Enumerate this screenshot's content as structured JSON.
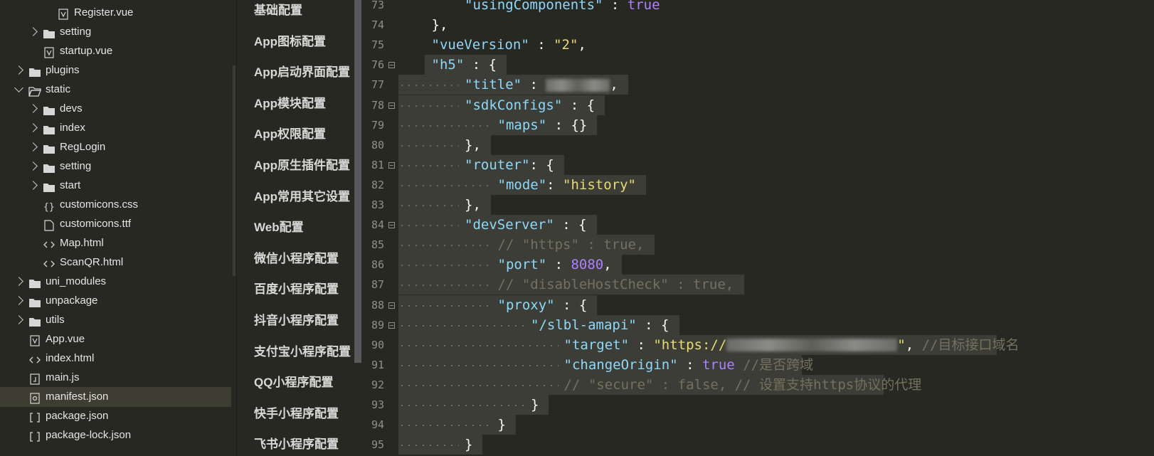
{
  "file_tree": {
    "items": [
      {
        "label": "Register.vue",
        "type": "vue",
        "depth": 3,
        "expanded": null
      },
      {
        "label": "setting",
        "type": "folder",
        "depth": 2,
        "expanded": false
      },
      {
        "label": "startup.vue",
        "type": "vue",
        "depth": 2,
        "expanded": null
      },
      {
        "label": "plugins",
        "type": "folder",
        "depth": 1,
        "expanded": false
      },
      {
        "label": "static",
        "type": "folder-open",
        "depth": 1,
        "expanded": true
      },
      {
        "label": "devs",
        "type": "folder",
        "depth": 2,
        "expanded": false
      },
      {
        "label": "index",
        "type": "folder",
        "depth": 2,
        "expanded": false
      },
      {
        "label": "RegLogin",
        "type": "folder",
        "depth": 2,
        "expanded": false
      },
      {
        "label": "setting",
        "type": "folder",
        "depth": 2,
        "expanded": false
      },
      {
        "label": "start",
        "type": "folder",
        "depth": 2,
        "expanded": false
      },
      {
        "label": "customicons.css",
        "type": "css",
        "depth": 2,
        "expanded": null
      },
      {
        "label": "customicons.ttf",
        "type": "file",
        "depth": 2,
        "expanded": null
      },
      {
        "label": "Map.html",
        "type": "html",
        "depth": 2,
        "expanded": null
      },
      {
        "label": "ScanQR.html",
        "type": "html",
        "depth": 2,
        "expanded": null
      },
      {
        "label": "uni_modules",
        "type": "folder",
        "depth": 1,
        "expanded": false
      },
      {
        "label": "unpackage",
        "type": "folder",
        "depth": 1,
        "expanded": false
      },
      {
        "label": "utils",
        "type": "folder",
        "depth": 1,
        "expanded": false
      },
      {
        "label": "App.vue",
        "type": "vue",
        "depth": 1,
        "expanded": null
      },
      {
        "label": "index.html",
        "type": "html",
        "depth": 1,
        "expanded": null
      },
      {
        "label": "main.js",
        "type": "js",
        "depth": 1,
        "expanded": null
      },
      {
        "label": "manifest.json",
        "type": "json-settings",
        "depth": 1,
        "expanded": null,
        "selected": true
      },
      {
        "label": "package.json",
        "type": "json",
        "depth": 1,
        "expanded": null
      },
      {
        "label": "package-lock.json",
        "type": "json",
        "depth": 1,
        "expanded": null
      }
    ]
  },
  "settings_nav": {
    "items": [
      "基础配置",
      "App图标配置",
      "App启动界面配置",
      "App模块配置",
      "App权限配置",
      "App原生插件配置",
      "App常用其它设置",
      "Web配置",
      "微信小程序配置",
      "百度小程序配置",
      "抖音小程序配置",
      "支付宝小程序配置",
      "QQ小程序配置",
      "快手小程序配置",
      "飞书小程序配置"
    ]
  },
  "editor": {
    "lines": [
      {
        "num": "73",
        "indent": 2,
        "fold": false,
        "tokens": [
          [
            "key",
            "\"usingComponents\""
          ],
          [
            "p",
            " : "
          ],
          [
            "kw",
            "true"
          ]
        ]
      },
      {
        "num": "74",
        "indent": 1,
        "fold": false,
        "tokens": [
          [
            "p",
            "},"
          ]
        ]
      },
      {
        "num": "75",
        "indent": 1,
        "fold": false,
        "tokens": [
          [
            "key",
            "\"vueVersion\""
          ],
          [
            "p",
            " : "
          ],
          [
            "str",
            "\"2\""
          ],
          [
            "p",
            ","
          ]
        ]
      },
      {
        "num": "76",
        "indent": 1,
        "fold": true,
        "tokens": [
          [
            "key",
            "\"h5\""
          ],
          [
            "p",
            " : {"
          ]
        ]
      },
      {
        "num": "77",
        "indent": 2,
        "fold": false,
        "tokens": [
          [
            "key",
            "\"title\""
          ],
          [
            "p",
            " : "
          ],
          [
            "blur",
            "90"
          ],
          [
            "p",
            ","
          ]
        ]
      },
      {
        "num": "78",
        "indent": 2,
        "fold": true,
        "tokens": [
          [
            "key",
            "\"sdkConfigs\""
          ],
          [
            "p",
            " : {"
          ]
        ]
      },
      {
        "num": "79",
        "indent": 3,
        "fold": false,
        "tokens": [
          [
            "key",
            "\"maps\""
          ],
          [
            "p",
            " : {}"
          ]
        ]
      },
      {
        "num": "80",
        "indent": 2,
        "fold": false,
        "tokens": [
          [
            "p",
            "},"
          ]
        ]
      },
      {
        "num": "81",
        "indent": 2,
        "fold": true,
        "tokens": [
          [
            "key",
            "\"router\""
          ],
          [
            "p",
            ": {"
          ]
        ]
      },
      {
        "num": "82",
        "indent": 3,
        "fold": false,
        "tokens": [
          [
            "key",
            "\"mode\""
          ],
          [
            "p",
            ": "
          ],
          [
            "str",
            "\"history\""
          ]
        ]
      },
      {
        "num": "83",
        "indent": 2,
        "fold": false,
        "tokens": [
          [
            "p",
            "},"
          ]
        ]
      },
      {
        "num": "84",
        "indent": 2,
        "fold": true,
        "tokens": [
          [
            "key",
            "\"devServer\""
          ],
          [
            "p",
            " : {"
          ]
        ]
      },
      {
        "num": "85",
        "indent": 3,
        "fold": false,
        "tokens": [
          [
            "cm",
            "// \"https\" : true,"
          ]
        ]
      },
      {
        "num": "86",
        "indent": 3,
        "fold": false,
        "tokens": [
          [
            "key",
            "\"port\""
          ],
          [
            "p",
            " : "
          ],
          [
            "num",
            "8080"
          ],
          [
            "p",
            ","
          ]
        ]
      },
      {
        "num": "87",
        "indent": 3,
        "fold": false,
        "tokens": [
          [
            "cm",
            "// \"disableHostCheck\" : true,"
          ]
        ]
      },
      {
        "num": "88",
        "indent": 3,
        "fold": true,
        "tokens": [
          [
            "key",
            "\"proxy\""
          ],
          [
            "p",
            " : {"
          ]
        ]
      },
      {
        "num": "89",
        "indent": 4,
        "fold": true,
        "tokens": [
          [
            "key",
            "\"/slbl-amapi\""
          ],
          [
            "p",
            " : {"
          ]
        ]
      },
      {
        "num": "90",
        "indent": 5,
        "fold": false,
        "tokens": [
          [
            "key",
            "\"target\""
          ],
          [
            "p",
            " : "
          ],
          [
            "str",
            "\"https://"
          ],
          [
            "blur",
            "240"
          ],
          [
            "str",
            "\""
          ],
          [
            "p",
            ", "
          ],
          [
            "cm",
            "//目标接口域名"
          ]
        ]
      },
      {
        "num": "91",
        "indent": 5,
        "fold": false,
        "tokens": [
          [
            "key",
            "\"changeOrigin\""
          ],
          [
            "p",
            " : "
          ],
          [
            "kw",
            "true"
          ],
          [
            "p",
            " "
          ],
          [
            "cm",
            "//是否跨域"
          ]
        ]
      },
      {
        "num": "92",
        "indent": 5,
        "fold": false,
        "tokens": [
          [
            "cm",
            "// \"secure\" : false, // 设置支持https协议的代理"
          ]
        ]
      },
      {
        "num": "93",
        "indent": 4,
        "fold": false,
        "tokens": [
          [
            "p",
            "}"
          ]
        ]
      },
      {
        "num": "94",
        "indent": 3,
        "fold": false,
        "tokens": [
          [
            "p",
            "}"
          ]
        ]
      },
      {
        "num": "95",
        "indent": 2,
        "fold": false,
        "tokens": [
          [
            "p",
            "}"
          ]
        ]
      }
    ]
  },
  "colors": {
    "background": "#272822",
    "key": "#8fd8f8",
    "string": "#e6db74",
    "keyword": "#ae81ff",
    "comment": "#75715e"
  }
}
